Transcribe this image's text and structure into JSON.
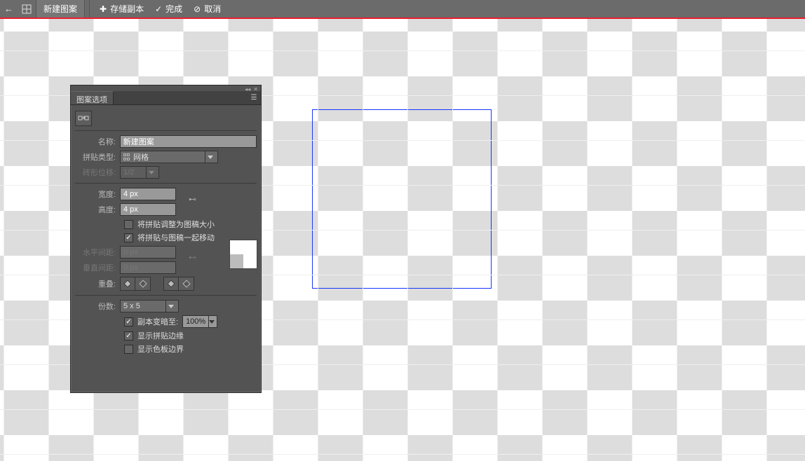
{
  "topbar": {
    "title": "新建图案",
    "save_copy": "存储副本",
    "done": "完成",
    "cancel": "取消"
  },
  "panel": {
    "tab_title": "图案选项",
    "name_label": "名称:",
    "name_value": "新建图案",
    "tile_type_label": "拼贴类型:",
    "tile_type_value": "网格",
    "brick_offset_label": "砖形位移:",
    "brick_offset_value": "1/2",
    "width_label": "宽度:",
    "width_value": "4 px",
    "height_label": "高度:",
    "height_value": "4 px",
    "cb_resize_tile": "将拼贴调整为图稿大小",
    "cb_move_with_art": "将拼贴与图稿一起移动",
    "h_spacing_label": "水平间距:",
    "h_spacing_value": "0 px",
    "v_spacing_label": "垂直间距:",
    "v_spacing_value": "0 px",
    "overlap_label": "重叠:",
    "copies_label": "份数:",
    "copies_value": "5 x 5",
    "dimmed_label": "副本变暗至:",
    "dimmed_value": "100%",
    "cb_show_tile_edge": "显示拼贴边缘",
    "cb_show_swatch_bounds": "显示色板边界"
  }
}
